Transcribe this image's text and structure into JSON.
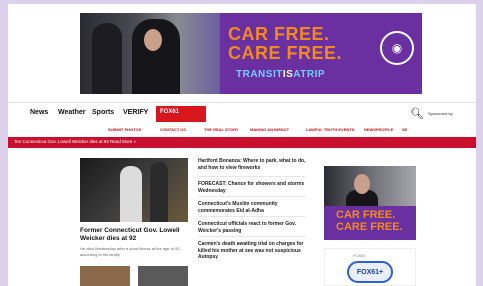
{
  "banner_ad": {
    "headline_line1": "CAR FREE.",
    "headline_line2": "CARE FREE.",
    "tagline_prefix": "TRANSIT",
    "tagline_mid": "IS",
    "tagline_suffix": "ATRIP",
    "brand_color": "#6a2fa0",
    "accent_color": "#f28a1e"
  },
  "nav": {
    "items": [
      "News",
      "Weather",
      "Sports",
      "VERIFY"
    ],
    "logo_label": "FOX61",
    "search_icon": "search-icon",
    "sponsor_text": "Sponsored by"
  },
  "subnav": {
    "items": [
      "SUBMIT PHOTOS",
      "CONTACT US",
      "THE REAL STORY",
      "MAKING AN IMPACT",
      "LAWFUL TRUTH EVENTS",
      "NEWSPROFILE",
      "SE"
    ]
  },
  "alert": {
    "text": "Ten Connecticut Gov. Lowell Weicker dies at 92 Read More »"
  },
  "lead": {
    "title": "Former Connecticut Gov. Lowell Weicker dies at 92",
    "desc": "He died Wednesday after a short illness at the age of 92, according to his family."
  },
  "headlines": [
    "Hartford Bonanza: Where to park, what to do, and how to view fireworks",
    "FORECAST: Chance for showers and storms Wednesday",
    "Connecticut's Muslim community commemorates Eid al-Adha",
    "Connecticut officials react to former Gov. Weicker's passing",
    "Carmen's death awaiting trial on charges for killed his mother at see was not suspicious Autopsy"
  ],
  "rail": {
    "ad_line1": "CAR FREE.",
    "ad_line2": "CARE FREE.",
    "logo_label": "FOX61",
    "logo_text": "FOX61+"
  }
}
